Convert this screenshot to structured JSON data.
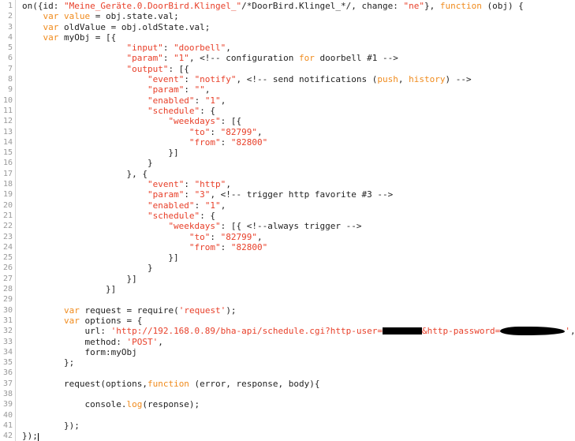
{
  "editor": {
    "language": "javascript",
    "total_lines": 42,
    "cursor_line": 42,
    "colors": {
      "background": "#ffffff",
      "text": "#1f1f1f",
      "string": "#e8402a",
      "keyword": "#f08b1d",
      "gutter_text": "#999999",
      "gutter_border": "#d4d4d4",
      "redaction": "#000000"
    },
    "line_numbers": [
      1,
      2,
      3,
      4,
      5,
      6,
      7,
      8,
      9,
      10,
      11,
      12,
      13,
      14,
      15,
      16,
      17,
      18,
      19,
      20,
      21,
      22,
      23,
      24,
      25,
      26,
      27,
      28,
      29,
      30,
      31,
      32,
      33,
      34,
      35,
      36,
      37,
      38,
      39,
      40,
      41,
      42
    ],
    "lines": [
      {
        "n": 1,
        "tokens": [
          {
            "t": "plain",
            "v": "on({id: "
          },
          {
            "t": "str",
            "v": "\"Meine_Geräte.0.DoorBird.Klingel_\""
          },
          {
            "t": "plain",
            "v": "/*DoorBird.Klingel_*/, change: "
          },
          {
            "t": "str",
            "v": "\"ne\""
          },
          {
            "t": "plain",
            "v": "}, "
          },
          {
            "t": "kw",
            "v": "function"
          },
          {
            "t": "plain",
            "v": " (obj) {"
          }
        ]
      },
      {
        "n": 2,
        "tokens": [
          {
            "t": "plain",
            "v": "    "
          },
          {
            "t": "kw",
            "v": "var value"
          },
          {
            "t": "plain",
            "v": " = obj.state.val;"
          }
        ]
      },
      {
        "n": 3,
        "tokens": [
          {
            "t": "plain",
            "v": "    "
          },
          {
            "t": "kw",
            "v": "var"
          },
          {
            "t": "plain",
            "v": " oldValue = obj.oldState.val;"
          }
        ]
      },
      {
        "n": 4,
        "tokens": [
          {
            "t": "plain",
            "v": "    "
          },
          {
            "t": "kw",
            "v": "var"
          },
          {
            "t": "plain",
            "v": " myObj = [{"
          }
        ]
      },
      {
        "n": 5,
        "tokens": [
          {
            "t": "plain",
            "v": "                    "
          },
          {
            "t": "str",
            "v": "\"input\""
          },
          {
            "t": "plain",
            "v": ": "
          },
          {
            "t": "str",
            "v": "\"doorbell\""
          },
          {
            "t": "plain",
            "v": ","
          }
        ]
      },
      {
        "n": 6,
        "tokens": [
          {
            "t": "plain",
            "v": "                    "
          },
          {
            "t": "str",
            "v": "\"param\""
          },
          {
            "t": "plain",
            "v": ": "
          },
          {
            "t": "str",
            "v": "\"1\""
          },
          {
            "t": "plain",
            "v": ", <!-- configuration "
          },
          {
            "t": "kw",
            "v": "for"
          },
          {
            "t": "plain",
            "v": " doorbell #1 -->"
          }
        ]
      },
      {
        "n": 7,
        "tokens": [
          {
            "t": "plain",
            "v": "                    "
          },
          {
            "t": "str",
            "v": "\"output\""
          },
          {
            "t": "plain",
            "v": ": [{"
          }
        ]
      },
      {
        "n": 8,
        "tokens": [
          {
            "t": "plain",
            "v": "                        "
          },
          {
            "t": "str",
            "v": "\"event\""
          },
          {
            "t": "plain",
            "v": ": "
          },
          {
            "t": "str",
            "v": "\"notify\""
          },
          {
            "t": "plain",
            "v": ", <!-- send notifications ("
          },
          {
            "t": "kw",
            "v": "push"
          },
          {
            "t": "plain",
            "v": ", "
          },
          {
            "t": "kw",
            "v": "history"
          },
          {
            "t": "plain",
            "v": ") -->"
          }
        ]
      },
      {
        "n": 9,
        "tokens": [
          {
            "t": "plain",
            "v": "                        "
          },
          {
            "t": "str",
            "v": "\"param\""
          },
          {
            "t": "plain",
            "v": ": "
          },
          {
            "t": "str",
            "v": "\"\""
          },
          {
            "t": "plain",
            "v": ","
          }
        ]
      },
      {
        "n": 10,
        "tokens": [
          {
            "t": "plain",
            "v": "                        "
          },
          {
            "t": "str",
            "v": "\"enabled\""
          },
          {
            "t": "plain",
            "v": ": "
          },
          {
            "t": "str",
            "v": "\"1\""
          },
          {
            "t": "plain",
            "v": ","
          }
        ]
      },
      {
        "n": 11,
        "tokens": [
          {
            "t": "plain",
            "v": "                        "
          },
          {
            "t": "str",
            "v": "\"schedule\""
          },
          {
            "t": "plain",
            "v": ": {"
          }
        ]
      },
      {
        "n": 12,
        "tokens": [
          {
            "t": "plain",
            "v": "                            "
          },
          {
            "t": "str",
            "v": "\"weekdays\""
          },
          {
            "t": "plain",
            "v": ": [{"
          }
        ]
      },
      {
        "n": 13,
        "tokens": [
          {
            "t": "plain",
            "v": "                                "
          },
          {
            "t": "str",
            "v": "\"to\""
          },
          {
            "t": "plain",
            "v": ": "
          },
          {
            "t": "str",
            "v": "\"82799\""
          },
          {
            "t": "plain",
            "v": ","
          }
        ]
      },
      {
        "n": 14,
        "tokens": [
          {
            "t": "plain",
            "v": "                                "
          },
          {
            "t": "str",
            "v": "\"from\""
          },
          {
            "t": "plain",
            "v": ": "
          },
          {
            "t": "str",
            "v": "\"82800\""
          }
        ]
      },
      {
        "n": 15,
        "tokens": [
          {
            "t": "plain",
            "v": "                            }]"
          }
        ]
      },
      {
        "n": 16,
        "tokens": [
          {
            "t": "plain",
            "v": "                        }"
          }
        ]
      },
      {
        "n": 17,
        "tokens": [
          {
            "t": "plain",
            "v": "                    }, {"
          }
        ]
      },
      {
        "n": 18,
        "tokens": [
          {
            "t": "plain",
            "v": "                        "
          },
          {
            "t": "str",
            "v": "\"event\""
          },
          {
            "t": "plain",
            "v": ": "
          },
          {
            "t": "str",
            "v": "\"http\""
          },
          {
            "t": "plain",
            "v": ","
          }
        ]
      },
      {
        "n": 19,
        "tokens": [
          {
            "t": "plain",
            "v": "                        "
          },
          {
            "t": "str",
            "v": "\"param\""
          },
          {
            "t": "plain",
            "v": ": "
          },
          {
            "t": "str",
            "v": "\"3\""
          },
          {
            "t": "plain",
            "v": ", <!-- trigger http favorite #3 -->"
          }
        ]
      },
      {
        "n": 20,
        "tokens": [
          {
            "t": "plain",
            "v": "                        "
          },
          {
            "t": "str",
            "v": "\"enabled\""
          },
          {
            "t": "plain",
            "v": ": "
          },
          {
            "t": "str",
            "v": "\"1\""
          },
          {
            "t": "plain",
            "v": ","
          }
        ]
      },
      {
        "n": 21,
        "tokens": [
          {
            "t": "plain",
            "v": "                        "
          },
          {
            "t": "str",
            "v": "\"schedule\""
          },
          {
            "t": "plain",
            "v": ": {"
          }
        ]
      },
      {
        "n": 22,
        "tokens": [
          {
            "t": "plain",
            "v": "                            "
          },
          {
            "t": "str",
            "v": "\"weekdays\""
          },
          {
            "t": "plain",
            "v": ": [{ <!--always trigger -->"
          }
        ]
      },
      {
        "n": 23,
        "tokens": [
          {
            "t": "plain",
            "v": "                                "
          },
          {
            "t": "str",
            "v": "\"to\""
          },
          {
            "t": "plain",
            "v": ": "
          },
          {
            "t": "str",
            "v": "\"82799\""
          },
          {
            "t": "plain",
            "v": ","
          }
        ]
      },
      {
        "n": 24,
        "tokens": [
          {
            "t": "plain",
            "v": "                                "
          },
          {
            "t": "str",
            "v": "\"from\""
          },
          {
            "t": "plain",
            "v": ": "
          },
          {
            "t": "str",
            "v": "\"82800\""
          }
        ]
      },
      {
        "n": 25,
        "tokens": [
          {
            "t": "plain",
            "v": "                            }]"
          }
        ]
      },
      {
        "n": 26,
        "tokens": [
          {
            "t": "plain",
            "v": "                        }"
          }
        ]
      },
      {
        "n": 27,
        "tokens": [
          {
            "t": "plain",
            "v": "                    }]"
          }
        ]
      },
      {
        "n": 28,
        "tokens": [
          {
            "t": "plain",
            "v": "                }]"
          }
        ]
      },
      {
        "n": 29,
        "tokens": [
          {
            "t": "plain",
            "v": ""
          }
        ]
      },
      {
        "n": 30,
        "tokens": [
          {
            "t": "plain",
            "v": "        "
          },
          {
            "t": "kw",
            "v": "var"
          },
          {
            "t": "plain",
            "v": " request = require("
          },
          {
            "t": "str",
            "v": "'request'"
          },
          {
            "t": "plain",
            "v": ");"
          }
        ]
      },
      {
        "n": 31,
        "tokens": [
          {
            "t": "plain",
            "v": "        "
          },
          {
            "t": "kw",
            "v": "var"
          },
          {
            "t": "plain",
            "v": " options = {"
          }
        ]
      },
      {
        "n": 32,
        "redactions": true,
        "tokens": [
          {
            "t": "plain",
            "v": "            url: "
          },
          {
            "t": "str",
            "v": "'http://192.168.0.89/bha-api/schedule.cgi?http-user="
          },
          {
            "t": "redact-a",
            "v": ""
          },
          {
            "t": "str",
            "v": "&http-password="
          },
          {
            "t": "redact-b",
            "v": ""
          },
          {
            "t": "str",
            "v": "'"
          },
          {
            "t": "plain",
            "v": ","
          }
        ]
      },
      {
        "n": 33,
        "tokens": [
          {
            "t": "plain",
            "v": "            method: "
          },
          {
            "t": "str",
            "v": "'POST'"
          },
          {
            "t": "plain",
            "v": ","
          }
        ]
      },
      {
        "n": 34,
        "tokens": [
          {
            "t": "plain",
            "v": "            form:myObj"
          }
        ]
      },
      {
        "n": 35,
        "tokens": [
          {
            "t": "plain",
            "v": "        };"
          }
        ]
      },
      {
        "n": 36,
        "tokens": [
          {
            "t": "plain",
            "v": ""
          }
        ]
      },
      {
        "n": 37,
        "tokens": [
          {
            "t": "plain",
            "v": "        request(options,"
          },
          {
            "t": "kw",
            "v": "function"
          },
          {
            "t": "plain",
            "v": " (error, response, body){"
          }
        ]
      },
      {
        "n": 38,
        "tokens": [
          {
            "t": "plain",
            "v": ""
          }
        ]
      },
      {
        "n": 39,
        "tokens": [
          {
            "t": "plain",
            "v": "            console."
          },
          {
            "t": "kw",
            "v": "log"
          },
          {
            "t": "plain",
            "v": "(response);"
          }
        ]
      },
      {
        "n": 40,
        "tokens": [
          {
            "t": "plain",
            "v": ""
          }
        ]
      },
      {
        "n": 41,
        "tokens": [
          {
            "t": "plain",
            "v": "        });"
          }
        ]
      },
      {
        "n": 42,
        "caret": true,
        "tokens": [
          {
            "t": "plain",
            "v": "});"
          }
        ]
      }
    ]
  }
}
